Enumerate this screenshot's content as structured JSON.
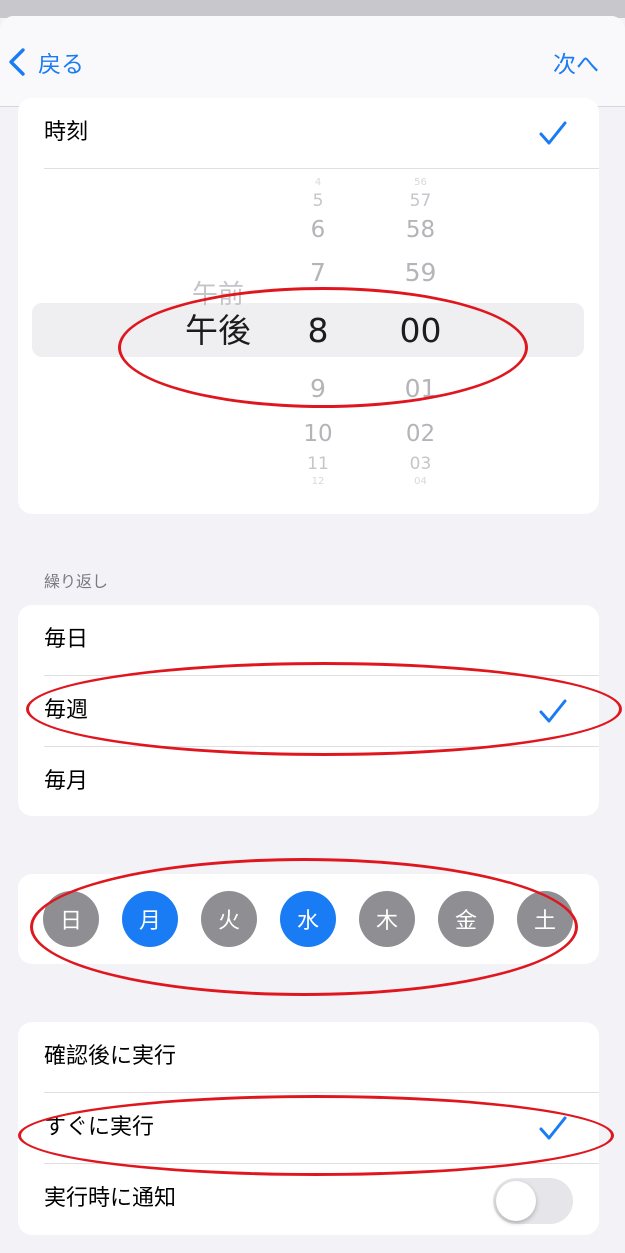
{
  "nav": {
    "back_label": "戻る",
    "next_label": "次へ"
  },
  "time_section": {
    "label": "時刻",
    "picker": {
      "period": {
        "items": [
          "午前",
          "午後"
        ],
        "selected": "午後"
      },
      "hour": {
        "items": [
          "4",
          "5",
          "6",
          "7",
          "8",
          "9",
          "10",
          "11",
          "12"
        ],
        "selected": "8"
      },
      "minute": {
        "items": [
          "56",
          "57",
          "58",
          "59",
          "00",
          "01",
          "02",
          "03",
          "04"
        ],
        "selected": "00"
      }
    }
  },
  "repeat_section": {
    "header": "繰り返し",
    "options": [
      {
        "label": "毎日",
        "checked": false
      },
      {
        "label": "毎週",
        "checked": true
      },
      {
        "label": "毎月",
        "checked": false
      }
    ]
  },
  "weekdays": [
    {
      "label": "日",
      "selected": false
    },
    {
      "label": "月",
      "selected": true
    },
    {
      "label": "火",
      "selected": false
    },
    {
      "label": "水",
      "selected": true
    },
    {
      "label": "木",
      "selected": false
    },
    {
      "label": "金",
      "selected": false
    },
    {
      "label": "土",
      "selected": false
    }
  ],
  "run_section": {
    "options": [
      {
        "label": "確認後に実行",
        "checked": false
      },
      {
        "label": "すぐに実行",
        "checked": true
      }
    ],
    "notify": {
      "label": "実行時に通知",
      "enabled": false
    }
  },
  "colors": {
    "accent": "#1a7cf5",
    "day_off": "#8e8e93",
    "annotation": "#e0161e"
  }
}
